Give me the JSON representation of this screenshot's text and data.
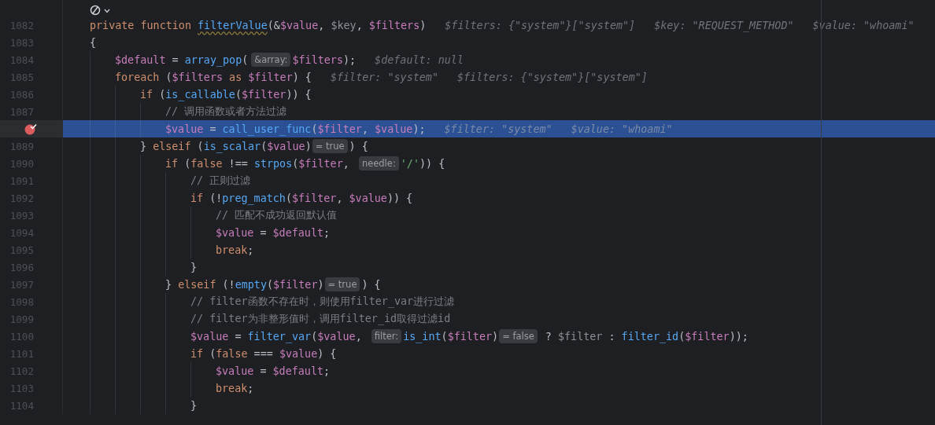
{
  "editor": {
    "lines": [
      {
        "number": "1082",
        "breakpoint": false,
        "current": false,
        "tokens": [
          {
            "kind": "kw",
            "text": "private function "
          },
          {
            "kind": "decl",
            "text": "filterValue"
          },
          {
            "kind": "text",
            "text": "(&"
          },
          {
            "kind": "var",
            "text": "$value"
          },
          {
            "kind": "text",
            "text": ", "
          },
          {
            "kind": "muted",
            "text": "$key"
          },
          {
            "kind": "text",
            "text": ", "
          },
          {
            "kind": "var",
            "text": "$filters"
          },
          {
            "kind": "text",
            "text": ")"
          },
          {
            "kind": "value",
            "text": "$filters: {\"system\"}[\"system\"]"
          },
          {
            "kind": "value",
            "text": "$key: \"REQUEST_METHOD\""
          },
          {
            "kind": "value",
            "text": "$value: \"whoami\""
          }
        ]
      },
      {
        "number": "1083",
        "breakpoint": false,
        "current": false,
        "tokens": [
          {
            "kind": "text",
            "text": "{"
          }
        ],
        "children": [
          {
            "number": "1084",
            "breakpoint": false,
            "current": false,
            "tokens": [
              {
                "kind": "var",
                "text": "$default"
              },
              {
                "kind": "text",
                "text": " = "
              },
              {
                "kind": "fn",
                "text": "array_pop"
              },
              {
                "kind": "text",
                "text": "("
              },
              {
                "kind": "param",
                "text": "&array:"
              },
              {
                "kind": "var",
                "text": "$filters"
              },
              {
                "kind": "text",
                "text": ");"
              },
              {
                "kind": "value",
                "text": "$default: null"
              }
            ]
          },
          {
            "number": "1085",
            "breakpoint": false,
            "current": false,
            "tokens": [
              {
                "kind": "kw",
                "text": "foreach"
              },
              {
                "kind": "text",
                "text": " ("
              },
              {
                "kind": "var",
                "text": "$filters"
              },
              {
                "kind": "kw",
                "text": " as "
              },
              {
                "kind": "var",
                "text": "$filter"
              },
              {
                "kind": "text",
                "text": ") {"
              },
              {
                "kind": "value",
                "text": "$filter: \"system\""
              },
              {
                "kind": "value",
                "text": "$filters: {\"system\"}[\"system\"]"
              }
            ],
            "children": [
              {
                "number": "1086",
                "breakpoint": false,
                "current": false,
                "tokens": [
                  {
                    "kind": "kw",
                    "text": "if"
                  },
                  {
                    "kind": "text",
                    "text": " ("
                  },
                  {
                    "kind": "fn",
                    "text": "is_callable"
                  },
                  {
                    "kind": "text",
                    "text": "("
                  },
                  {
                    "kind": "var",
                    "text": "$filter"
                  },
                  {
                    "kind": "text",
                    "text": ")) {"
                  }
                ],
                "children": [
                  {
                    "number": "1087",
                    "breakpoint": false,
                    "current": false,
                    "tokens": [
                      {
                        "kind": "comment",
                        "text": "// 调用函数或者方法过滤"
                      }
                    ]
                  },
                  {
                    "breakpoint": true,
                    "current": true,
                    "tokens": [
                      {
                        "kind": "var",
                        "text": "$value"
                      },
                      {
                        "kind": "text",
                        "text": " = "
                      },
                      {
                        "kind": "fn",
                        "text": "call_user_func"
                      },
                      {
                        "kind": "text",
                        "text": "("
                      },
                      {
                        "kind": "var",
                        "text": "$filter"
                      },
                      {
                        "kind": "text",
                        "text": ", "
                      },
                      {
                        "kind": "var",
                        "text": "$value"
                      },
                      {
                        "kind": "text",
                        "text": ");"
                      },
                      {
                        "kind": "value",
                        "text": "$filter: \"system\""
                      },
                      {
                        "kind": "value",
                        "text": "$value: \"whoami\""
                      }
                    ]
                  }
                ]
              },
              {
                "number": "1089",
                "breakpoint": false,
                "current": false,
                "tokens": [
                  {
                    "kind": "text",
                    "text": "} "
                  },
                  {
                    "kind": "kw",
                    "text": "elseif"
                  },
                  {
                    "kind": "text",
                    "text": " ("
                  },
                  {
                    "kind": "fn",
                    "text": "is_scalar"
                  },
                  {
                    "kind": "text",
                    "text": "("
                  },
                  {
                    "kind": "var",
                    "text": "$value"
                  },
                  {
                    "kind": "text",
                    "text": ")"
                  },
                  {
                    "kind": "result",
                    "text": "= true"
                  },
                  {
                    "kind": "text",
                    "text": ") {"
                  }
                ],
                "children": [
                  {
                    "number": "1090",
                    "breakpoint": false,
                    "current": false,
                    "tokens": [
                      {
                        "kind": "kw",
                        "text": "if"
                      },
                      {
                        "kind": "text",
                        "text": " ("
                      },
                      {
                        "kind": "kw",
                        "text": "false"
                      },
                      {
                        "kind": "text",
                        "text": " !== "
                      },
                      {
                        "kind": "fn",
                        "text": "strpos"
                      },
                      {
                        "kind": "text",
                        "text": "("
                      },
                      {
                        "kind": "var",
                        "text": "$filter"
                      },
                      {
                        "kind": "text",
                        "text": ", "
                      },
                      {
                        "kind": "param",
                        "text": "needle:"
                      },
                      {
                        "kind": "str",
                        "text": "'/'"
                      },
                      {
                        "kind": "text",
                        "text": ")) {"
                      }
                    ],
                    "children": [
                      {
                        "number": "1091",
                        "breakpoint": false,
                        "current": false,
                        "tokens": [
                          {
                            "kind": "comment",
                            "text": "// 正则过滤"
                          }
                        ]
                      },
                      {
                        "number": "1092",
                        "breakpoint": false,
                        "current": false,
                        "tokens": [
                          {
                            "kind": "kw",
                            "text": "if"
                          },
                          {
                            "kind": "text",
                            "text": " (!"
                          },
                          {
                            "kind": "fn",
                            "text": "preg_match"
                          },
                          {
                            "kind": "text",
                            "text": "("
                          },
                          {
                            "kind": "var",
                            "text": "$filter"
                          },
                          {
                            "kind": "text",
                            "text": ", "
                          },
                          {
                            "kind": "var",
                            "text": "$value"
                          },
                          {
                            "kind": "text",
                            "text": ")) {"
                          }
                        ],
                        "children": [
                          {
                            "number": "1093",
                            "breakpoint": false,
                            "current": false,
                            "tokens": [
                              {
                                "kind": "comment",
                                "text": "// 匹配不成功返回默认值"
                              }
                            ]
                          },
                          {
                            "number": "1094",
                            "breakpoint": false,
                            "current": false,
                            "tokens": [
                              {
                                "kind": "var",
                                "text": "$value"
                              },
                              {
                                "kind": "text",
                                "text": " = "
                              },
                              {
                                "kind": "var",
                                "text": "$default"
                              },
                              {
                                "kind": "text",
                                "text": ";"
                              }
                            ]
                          },
                          {
                            "number": "1095",
                            "breakpoint": false,
                            "current": false,
                            "tokens": [
                              {
                                "kind": "kw",
                                "text": "break"
                              },
                              {
                                "kind": "text",
                                "text": ";"
                              }
                            ]
                          }
                        ]
                      },
                      {
                        "number": "1096",
                        "breakpoint": false,
                        "current": false,
                        "tokens": [
                          {
                            "kind": "text",
                            "text": "}"
                          }
                        ]
                      }
                    ]
                  },
                  {
                    "number": "1097",
                    "breakpoint": false,
                    "current": false,
                    "tokens": [
                      {
                        "kind": "text",
                        "text": "} "
                      },
                      {
                        "kind": "kw",
                        "text": "elseif"
                      },
                      {
                        "kind": "text",
                        "text": " (!"
                      },
                      {
                        "kind": "fn",
                        "text": "empty"
                      },
                      {
                        "kind": "text",
                        "text": "("
                      },
                      {
                        "kind": "var",
                        "text": "$filter"
                      },
                      {
                        "kind": "text",
                        "text": ")"
                      },
                      {
                        "kind": "result",
                        "text": "= true"
                      },
                      {
                        "kind": "text",
                        "text": ") {"
                      }
                    ],
                    "children": [
                      {
                        "number": "1098",
                        "breakpoint": false,
                        "current": false,
                        "tokens": [
                          {
                            "kind": "comment",
                            "text": "// filter函数不存在时，则使用filter_var进行过滤"
                          }
                        ]
                      },
                      {
                        "number": "1099",
                        "breakpoint": false,
                        "current": false,
                        "tokens": [
                          {
                            "kind": "comment",
                            "text": "// filter为非整形值时，调用filter_id取得过滤id"
                          }
                        ]
                      },
                      {
                        "number": "1100",
                        "breakpoint": false,
                        "current": false,
                        "tokens": [
                          {
                            "kind": "var",
                            "text": "$value"
                          },
                          {
                            "kind": "text",
                            "text": " = "
                          },
                          {
                            "kind": "fn",
                            "text": "filter_var"
                          },
                          {
                            "kind": "text",
                            "text": "("
                          },
                          {
                            "kind": "var",
                            "text": "$value"
                          },
                          {
                            "kind": "text",
                            "text": ", "
                          },
                          {
                            "kind": "param",
                            "text": "filter:"
                          },
                          {
                            "kind": "fn",
                            "text": "is_int"
                          },
                          {
                            "kind": "text",
                            "text": "("
                          },
                          {
                            "kind": "var",
                            "text": "$filter"
                          },
                          {
                            "kind": "text",
                            "text": ")"
                          },
                          {
                            "kind": "result",
                            "text": "= false"
                          },
                          {
                            "kind": "text",
                            "text": " ? "
                          },
                          {
                            "kind": "muted",
                            "text": "$filter"
                          },
                          {
                            "kind": "text",
                            "text": " : "
                          },
                          {
                            "kind": "fn",
                            "text": "filter_id"
                          },
                          {
                            "kind": "text",
                            "text": "("
                          },
                          {
                            "kind": "var",
                            "text": "$filter"
                          },
                          {
                            "kind": "text",
                            "text": "));"
                          }
                        ]
                      },
                      {
                        "number": "1101",
                        "breakpoint": false,
                        "current": false,
                        "tokens": [
                          {
                            "kind": "kw",
                            "text": "if"
                          },
                          {
                            "kind": "text",
                            "text": " ("
                          },
                          {
                            "kind": "kw",
                            "text": "false"
                          },
                          {
                            "kind": "text",
                            "text": " === "
                          },
                          {
                            "kind": "var",
                            "text": "$value"
                          },
                          {
                            "kind": "text",
                            "text": ") {"
                          }
                        ],
                        "children": [
                          {
                            "number": "1102",
                            "breakpoint": false,
                            "current": false,
                            "tokens": [
                              {
                                "kind": "var",
                                "text": "$value"
                              },
                              {
                                "kind": "text",
                                "text": " = "
                              },
                              {
                                "kind": "var",
                                "text": "$default"
                              },
                              {
                                "kind": "text",
                                "text": ";"
                              }
                            ]
                          },
                          {
                            "number": "1103",
                            "breakpoint": false,
                            "current": false,
                            "tokens": [
                              {
                                "kind": "kw",
                                "text": "break"
                              },
                              {
                                "kind": "text",
                                "text": ";"
                              }
                            ]
                          }
                        ]
                      },
                      {
                        "number": "1104",
                        "breakpoint": false,
                        "current": false,
                        "tokens": [
                          {
                            "kind": "text",
                            "text": "}"
                          }
                        ]
                      }
                    ]
                  }
                ]
              }
            ]
          }
        ]
      }
    ]
  }
}
